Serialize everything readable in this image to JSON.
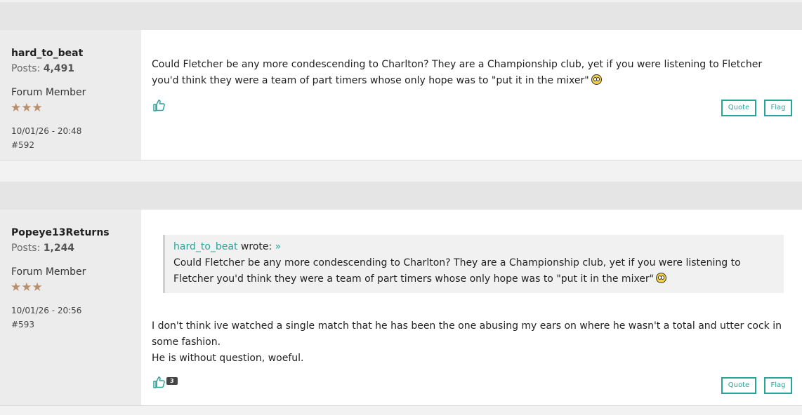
{
  "posts": [
    {
      "username": "hard_to_beat",
      "posts_label": "Posts:",
      "posts_count": "4,491",
      "rank": "Forum Member",
      "stars": "★★★",
      "date": "10/01/26 - 20:48",
      "post_number": "#592",
      "body": "Could Fletcher be any more condescending to Charlton? They are a Championship club, yet if you were listening to Fletcher you'd think they were a team of part timers whose only hope was to \"put it in the mixer\"",
      "quote_label": "Quote",
      "flag_label": "Flag",
      "like_icon": "thumbs-up-icon",
      "emoji_icon": "rolling-eyes-emoji"
    },
    {
      "username": "Popeye13Returns",
      "posts_label": "Posts:",
      "posts_count": "1,244",
      "rank": "Forum Member",
      "stars": "★★★",
      "date": "10/01/26 - 20:56",
      "post_number": "#593",
      "quoted_author": "hard_to_beat",
      "quoted_wrote": " wrote: ",
      "quoted_arrow": "»",
      "quoted_body": "Could Fletcher be any more condescending to Charlton? They are a Championship club, yet if you were listening to Fletcher you'd think they were a team of part timers whose only hope was to \"put it in the mixer\"",
      "body_line1": "I don't think ive watched a single match that he has been the one abusing my ears on where he wasn't a total and utter cock in some fashion.",
      "body_line2": "He is without question, woeful.",
      "like_count": "3",
      "quote_label": "Quote",
      "flag_label": "Flag",
      "like_icon": "thumbs-up-icon",
      "emoji_icon": "rolling-eyes-emoji"
    }
  ],
  "colors": {
    "accent": "#26a69a",
    "star": "#b88f6e",
    "header_bar": "#e5e5e5",
    "author_panel": "#ececec"
  }
}
